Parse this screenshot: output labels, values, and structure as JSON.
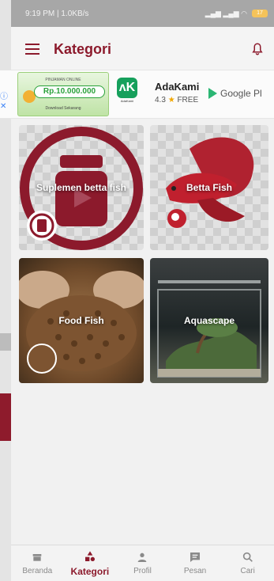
{
  "status_bar": {
    "time_speed": "9:19 PM | 1.0KB/s",
    "battery": "17"
  },
  "app_bar": {
    "title": "Kategori"
  },
  "ad": {
    "banner_top": "PINJAMAN ONLINE",
    "banner_amount": "Rp.10.000.000",
    "banner_foot": "Download Sekarang",
    "app_logo_caption": "AdaKami",
    "app_name": "AdaKami",
    "rating": "4.3",
    "price": "FREE",
    "store": "Google Pl"
  },
  "categories": [
    {
      "label": "Suplemen betta fish"
    },
    {
      "label": "Betta Fish"
    },
    {
      "label": "Food Fish"
    },
    {
      "label": "Aquascape"
    }
  ],
  "bottom_nav": {
    "items": [
      {
        "label": "Beranda",
        "icon": "store-icon"
      },
      {
        "label": "Kategori",
        "icon": "shapes-icon"
      },
      {
        "label": "Profil",
        "icon": "person-icon"
      },
      {
        "label": "Pesan",
        "icon": "message-icon"
      },
      {
        "label": "Cari",
        "icon": "search-icon"
      }
    ],
    "active_index": 1
  },
  "colors": {
    "accent": "#8c1a2c"
  }
}
